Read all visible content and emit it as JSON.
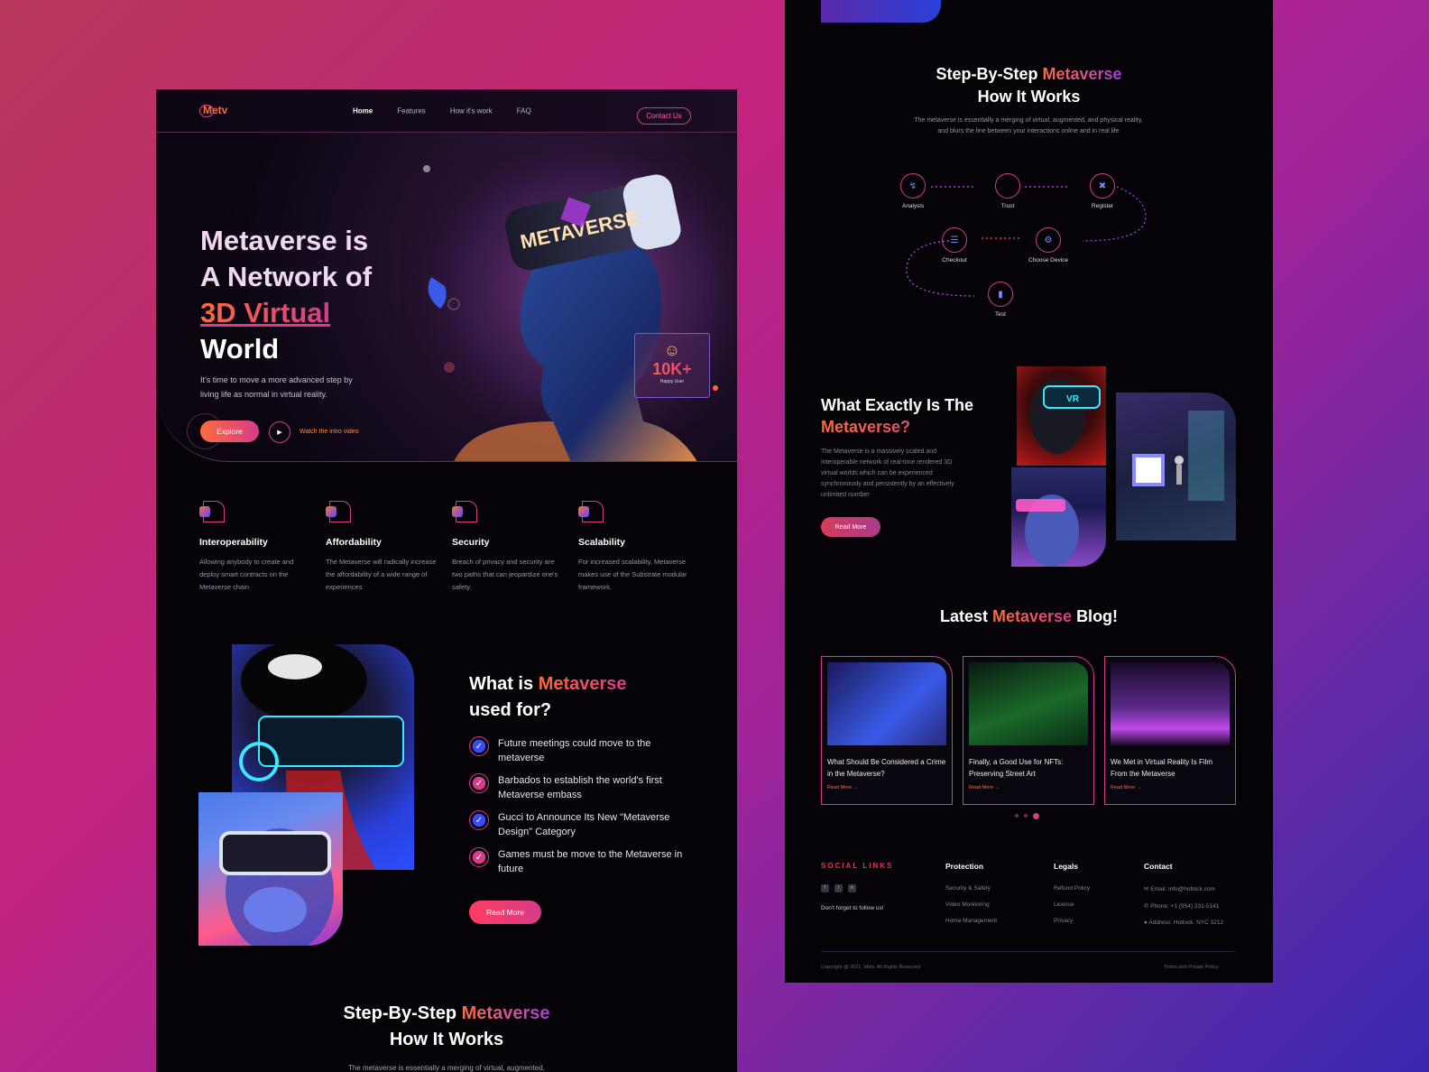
{
  "nav": {
    "logo": "Metv",
    "links": [
      "Home",
      "Features",
      "How it's work",
      "FAQ"
    ],
    "contact": "Contact Us"
  },
  "hero": {
    "title_l1": "Metaverse is",
    "title_l2": "A Network of",
    "title_l3": "3D Virtual",
    "title_l4": "World",
    "subtitle": "It's time to move a more advanced step by living life as normal in virtual reality.",
    "explore": "Explore",
    "watch": "Watch the intro video",
    "headset_text": "METAVERSE",
    "badge_num": "10K+",
    "badge_label": "Happy User"
  },
  "features": [
    {
      "title": "Interoperability",
      "text": "Allowing anybody to create and deploy smart contracts on the Metaverse chain"
    },
    {
      "title": "Affordability",
      "text": "The Metaverse will radically increase the affordability of a wide range of experiences"
    },
    {
      "title": "Security",
      "text": "Breach of privacy and security are two paths that can jeopardize one's safety."
    },
    {
      "title": "Scalability",
      "text": "For increased scalability, Metaverse makes use of the Substrate modular framework."
    }
  ],
  "usedfor": {
    "title_a": "What is",
    "title_b": "Metaverse",
    "title_c": "used for?",
    "items": [
      "Future meetings could move to the metaverse",
      "Barbados to establish the world's first Metaverse embass",
      "Gucci to Announce Its New \"Metaverse Design\" Category",
      "Games must be move to the Metaverse in future"
    ],
    "button": "Read More"
  },
  "steps": {
    "title_a": "Step-By-Step",
    "title_b": "Metaverse",
    "title_c": "How It Works",
    "sub_left": "The metaverse is essentially a merging of virtual, augmented,",
    "sub": "The metaverse is essentially a merging of virtual, augmented, and physical reality, and blurs the line between your interactions online and in real life",
    "labels": [
      "Analysis",
      "Trust",
      "Register",
      "Checkout",
      "Choose Device",
      "Test"
    ]
  },
  "what": {
    "title_a": "What Exactly Is The",
    "title_b": "Metaverse?",
    "text": "The Metaverse is a massively scaled and interoperable network of real-time rendered 3D virtual worlds which can be experienced synchronously and persistently by an effectively unlimited number",
    "button": "Read More",
    "img_vr_label": "VR"
  },
  "blog": {
    "title_a": "Latest",
    "title_b": "Metaverse",
    "title_c": "Blog!",
    "cards": [
      {
        "title": "What Should Be Considered a Crime in the Metaverse?",
        "link": "Read More →"
      },
      {
        "title": "Finally, a Good Use for NFTs: Preserving Street Art",
        "link": "Read More →"
      },
      {
        "title": "We Met in Virtual Reality Is Film From the Metaverse",
        "link": "Read More →"
      }
    ]
  },
  "footer": {
    "social_title": "SOCIAL LINKS",
    "social_icons": [
      "f",
      "t",
      "in"
    ],
    "follow": "Don't forget to follow us!",
    "protection_title": "Protection",
    "protection": [
      "Security & Safety",
      "Video Monitoring",
      "Home Management"
    ],
    "legals_title": "Legals",
    "legals": [
      "Refund Policy",
      "Licence",
      "Privacy"
    ],
    "contact_title": "Contact",
    "contact": [
      "Email: info@hotlock.com",
      "Phone: +1 (954) 231-5141",
      "Address: Hotlock, NYC 3212"
    ],
    "copyright": "Copyright @ 2021. Metv. All Rights Reserved",
    "terms": "Terms and Private Policy"
  }
}
